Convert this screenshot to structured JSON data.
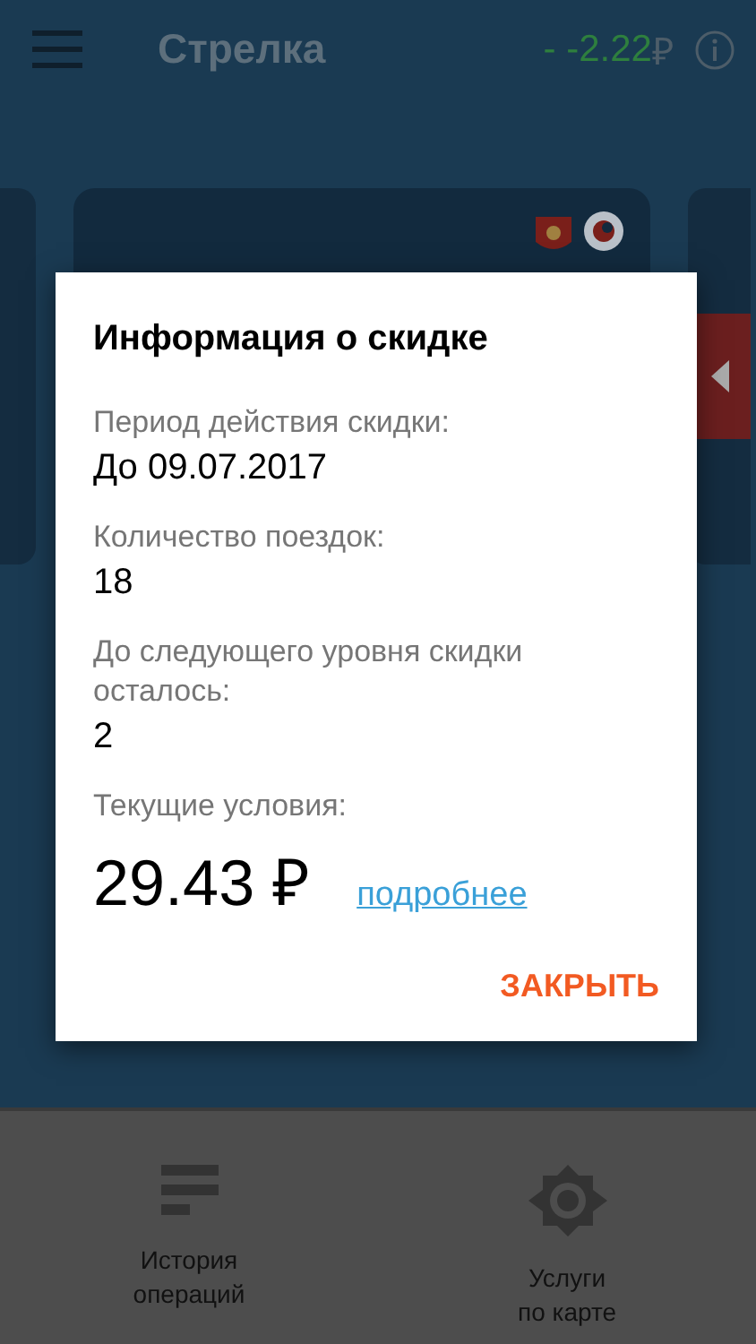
{
  "header": {
    "title": "Стрелка",
    "balance": "- -2.22",
    "currency": "₽"
  },
  "dialog": {
    "title": "Информация о скидке",
    "fields": [
      {
        "label": "Период действия скидки:",
        "value": "До 09.07.2017"
      },
      {
        "label": "Количество поездок:",
        "value": "18"
      },
      {
        "label": "До следующего уровня скидки осталось:",
        "value": "2"
      }
    ],
    "price": {
      "label": "Текущие условия:",
      "value": "29.43 ₽",
      "link": "подробнее"
    },
    "close": "ЗАКРЫТЬ"
  },
  "bottom_nav": [
    {
      "kind": "history",
      "label": "История\nопераций"
    },
    {
      "kind": "services",
      "label": "Услуги\nпо карте"
    }
  ]
}
